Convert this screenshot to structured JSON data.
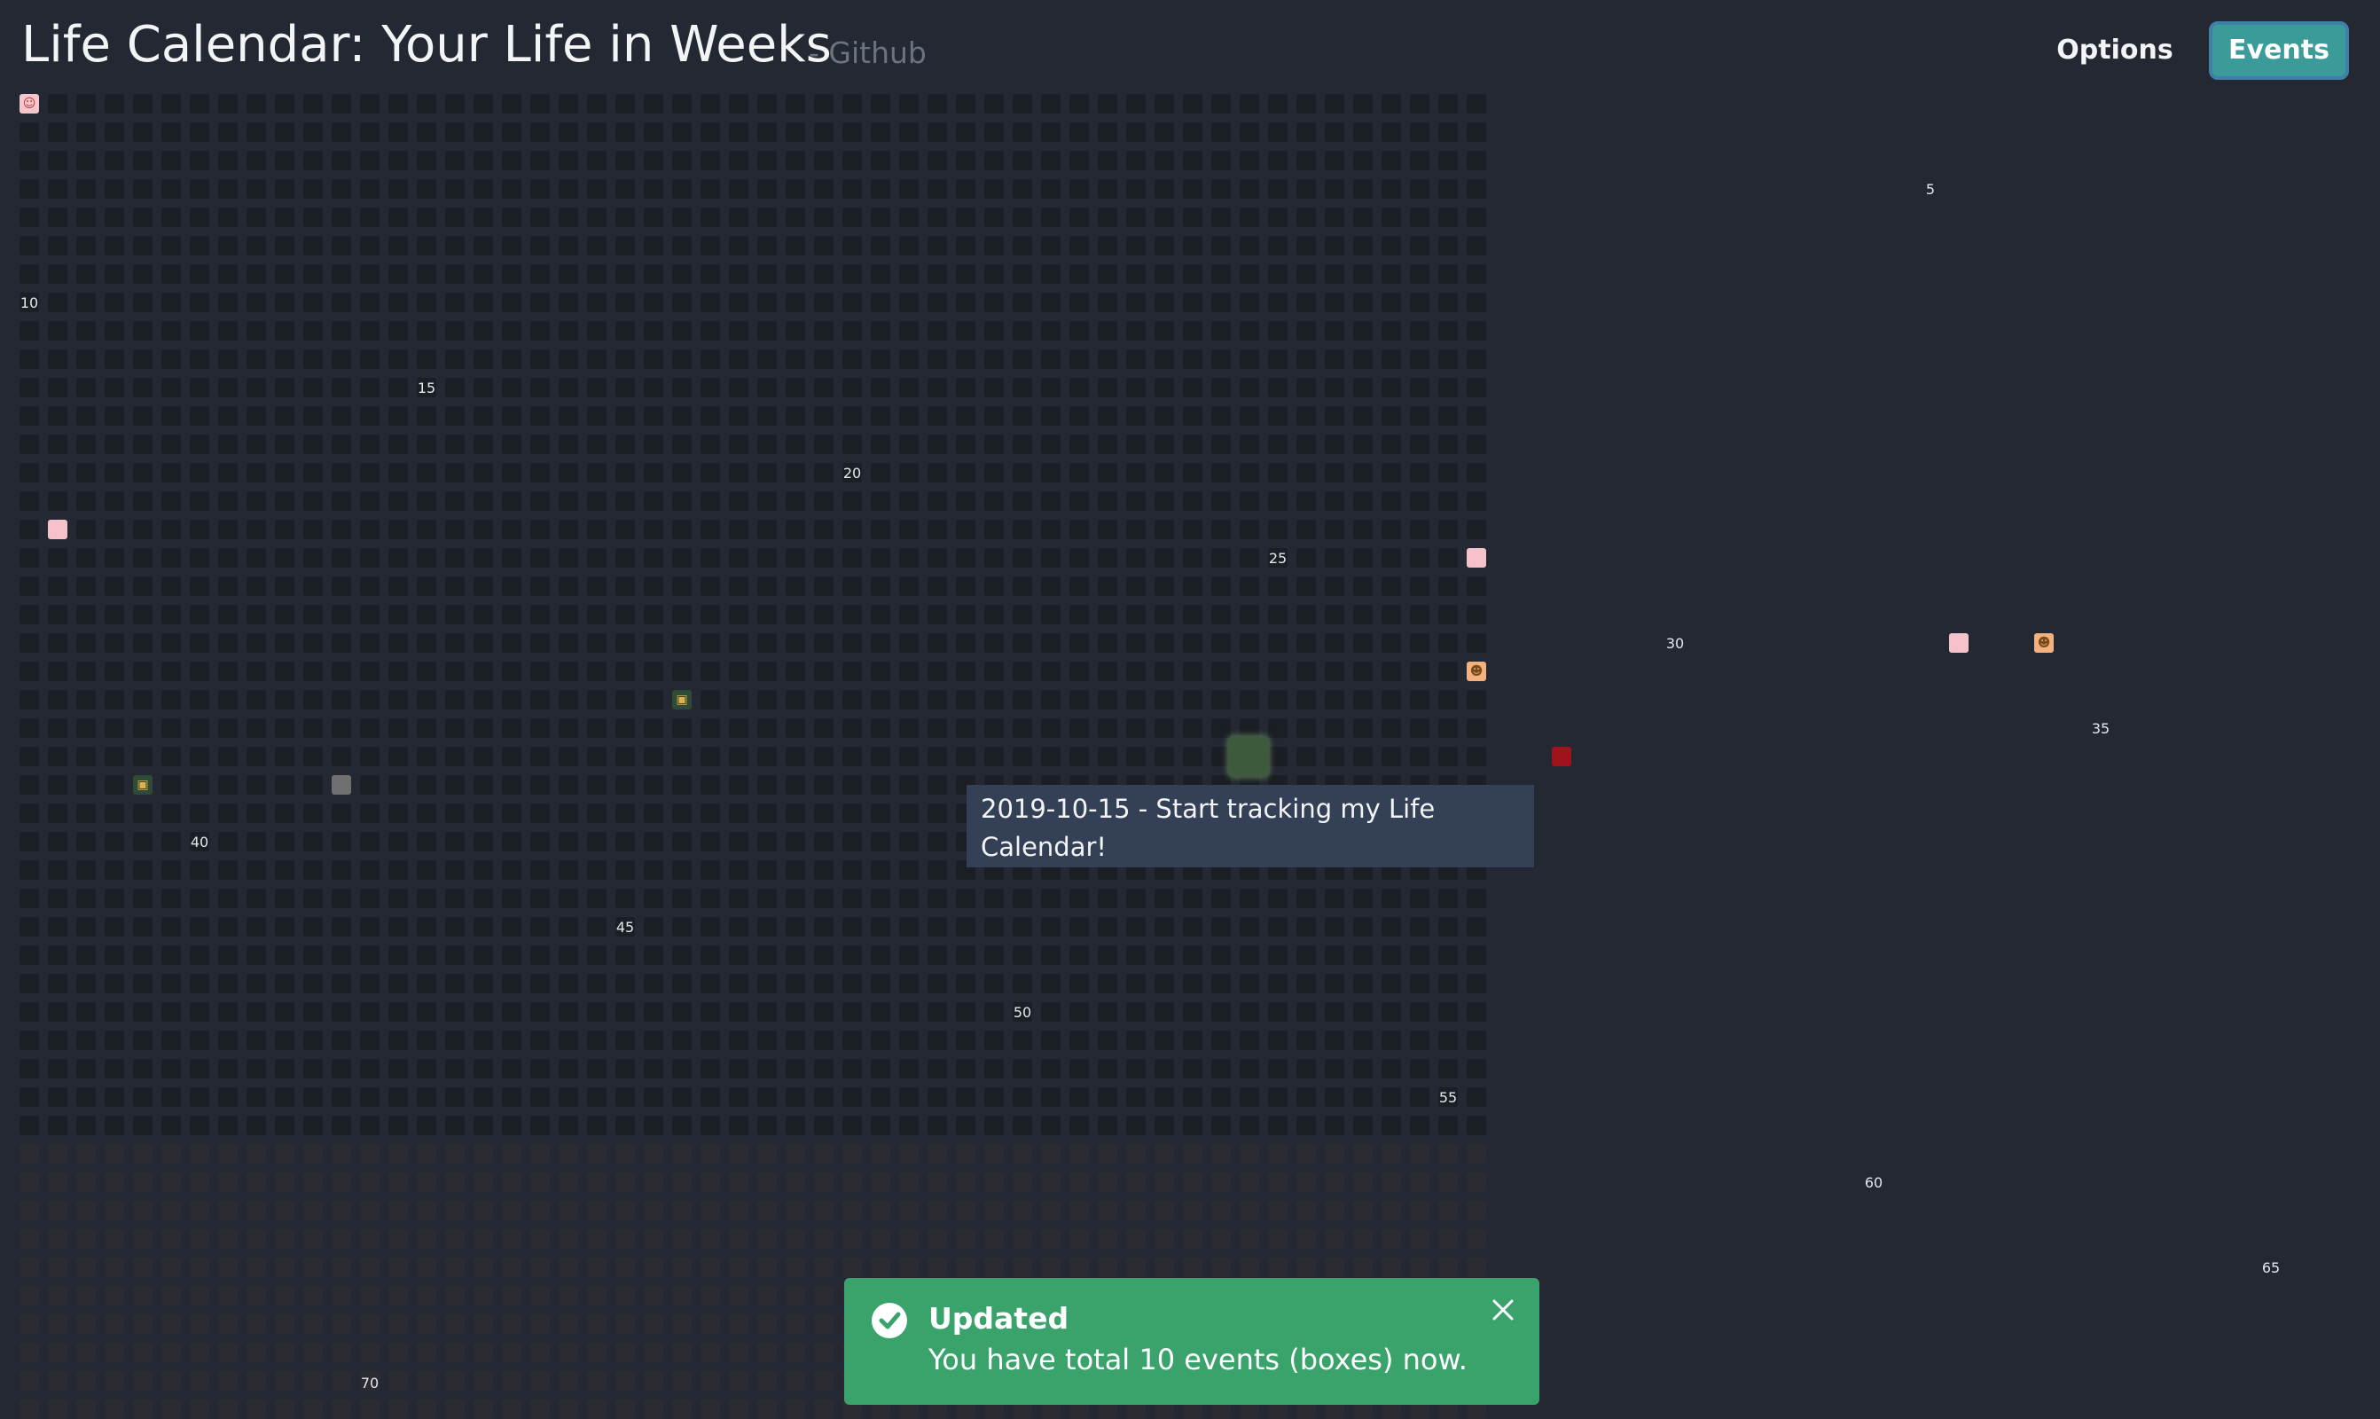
{
  "header": {
    "title": "Life Calendar: Your Life in Weeks",
    "subtitle": "- Github",
    "options_label": "Options",
    "events_label": "Events"
  },
  "calendar": {
    "weeks_per_year": 52,
    "years_shown": 47,
    "weeks_lived_count": 1924,
    "year_labels": [
      "5",
      "10",
      "15",
      "20",
      "25",
      "30",
      "35",
      "40",
      "45",
      "50",
      "55",
      "60",
      "65",
      "70"
    ],
    "event_colors": [
      "pink",
      "pink",
      "pink",
      "pink",
      "red",
      "gray"
    ],
    "colors": {
      "past": "#1b1e24",
      "future": "#2a2c31",
      "accent": "#3b9b98",
      "toast": "#3aa26b",
      "tooltip": "#334055"
    }
  },
  "tooltip": {
    "text": "2019-10-15 - Start tracking my Life Calendar!"
  },
  "toast": {
    "icon": "check-circle-icon",
    "title": "Updated",
    "message": "You have total 10 events (boxes) now.",
    "close_icon": "close-icon"
  }
}
